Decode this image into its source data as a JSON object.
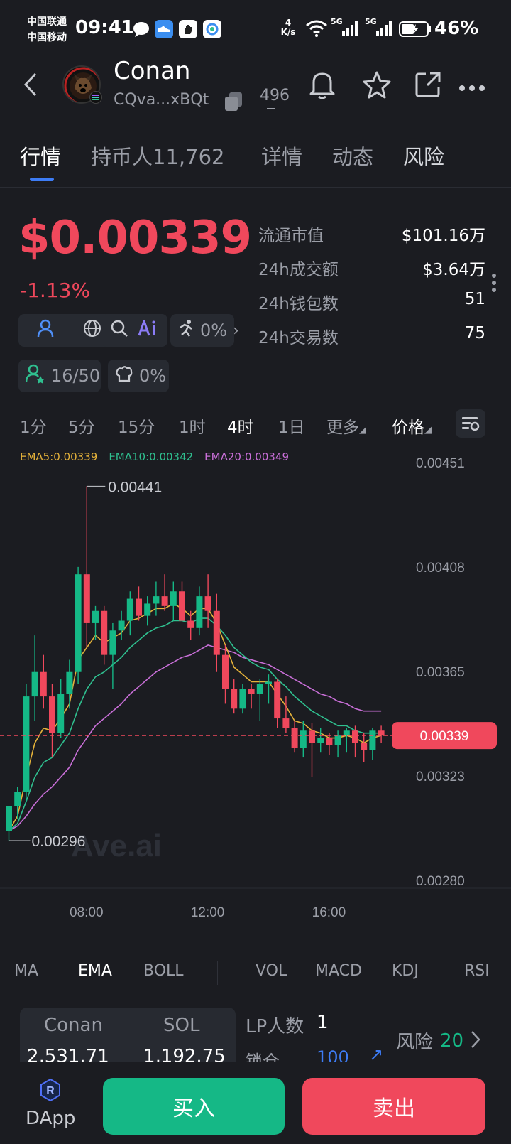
{
  "status_bar": {
    "carrier1": "中国联通",
    "carrier2": "中国移动",
    "time": "09:41",
    "net_speed_top": "4",
    "net_speed_bottom": "K/s",
    "sim1": "5G",
    "sim2": "5G",
    "battery": "46%"
  },
  "header": {
    "title": "Conan",
    "address": "CQva...xBQt",
    "count": "496"
  },
  "tabs": [
    {
      "label": "行情"
    },
    {
      "label": "持币人"
    },
    {
      "label": "详情"
    },
    {
      "label": "动态"
    },
    {
      "label": "风险"
    }
  ],
  "holders_count": "11,762",
  "price": {
    "value": "$0.00339",
    "change": "-1.13%",
    "chip_pct": "0%",
    "holders_ratio": "16/50",
    "chef_pct": "0%"
  },
  "stats": [
    {
      "label": "流通市值",
      "value": "$101.16万"
    },
    {
      "label": "24h成交额",
      "value": "$3.64万"
    },
    {
      "label": "24h钱包数",
      "value": "51"
    },
    {
      "label": "24h交易数",
      "value": "75"
    }
  ],
  "timeframes": [
    "1分",
    "5分",
    "15分",
    "1时",
    "4时",
    "1日",
    "更多",
    "价格"
  ],
  "ema_legend": {
    "ema5": "EMA5:0.00339",
    "ema10": "EMA10:0.00342",
    "ema20": "EMA20:0.00349"
  },
  "colors": {
    "up": "#15b886",
    "down": "#f0485c",
    "ema5": "#e5b23a",
    "ema10": "#2fbf8f",
    "ema20": "#c96fd8",
    "accent": "#3d7cf5"
  },
  "chart_data": {
    "type": "candlestick",
    "y_ticks": [
      "0.00451",
      "0.00408",
      "0.00365",
      "0.00323",
      "0.00280"
    ],
    "ylim": [
      0.0028,
      0.00451
    ],
    "x_ticks": [
      "08:00",
      "12:00",
      "16:00"
    ],
    "high_marker": "0.00441",
    "low_marker": "0.00296",
    "current_price": "0.00339",
    "watermark": "Ave.ai",
    "candles": [
      {
        "o": 0.003,
        "h": 0.0031,
        "l": 0.00296,
        "c": 0.0031
      },
      {
        "o": 0.0031,
        "h": 0.00318,
        "l": 0.00305,
        "c": 0.00316
      },
      {
        "o": 0.00316,
        "h": 0.0036,
        "l": 0.00312,
        "c": 0.00355
      },
      {
        "o": 0.00355,
        "h": 0.0038,
        "l": 0.00345,
        "c": 0.00365
      },
      {
        "o": 0.00365,
        "h": 0.00372,
        "l": 0.0035,
        "c": 0.00355
      },
      {
        "o": 0.00355,
        "h": 0.0036,
        "l": 0.0033,
        "c": 0.0034
      },
      {
        "o": 0.0034,
        "h": 0.00362,
        "l": 0.00338,
        "c": 0.00356
      },
      {
        "o": 0.00356,
        "h": 0.0037,
        "l": 0.0035,
        "c": 0.00365
      },
      {
        "o": 0.00365,
        "h": 0.00408,
        "l": 0.0036,
        "c": 0.00405
      },
      {
        "o": 0.00405,
        "h": 0.00441,
        "l": 0.00375,
        "c": 0.00385
      },
      {
        "o": 0.00385,
        "h": 0.00392,
        "l": 0.00378,
        "c": 0.0039
      },
      {
        "o": 0.0039,
        "h": 0.00392,
        "l": 0.00368,
        "c": 0.00372
      },
      {
        "o": 0.00372,
        "h": 0.00385,
        "l": 0.00358,
        "c": 0.00382
      },
      {
        "o": 0.00382,
        "h": 0.0039,
        "l": 0.00378,
        "c": 0.00386
      },
      {
        "o": 0.00386,
        "h": 0.00398,
        "l": 0.0038,
        "c": 0.00395
      },
      {
        "o": 0.00395,
        "h": 0.004,
        "l": 0.00386,
        "c": 0.00388
      },
      {
        "o": 0.00388,
        "h": 0.00396,
        "l": 0.00384,
        "c": 0.00393
      },
      {
        "o": 0.00393,
        "h": 0.00402,
        "l": 0.00388,
        "c": 0.00396
      },
      {
        "o": 0.00396,
        "h": 0.00405,
        "l": 0.0039,
        "c": 0.00392
      },
      {
        "o": 0.00392,
        "h": 0.00402,
        "l": 0.00386,
        "c": 0.00398
      },
      {
        "o": 0.00398,
        "h": 0.00402,
        "l": 0.0039,
        "c": 0.00386
      },
      {
        "o": 0.00386,
        "h": 0.0039,
        "l": 0.00378,
        "c": 0.00383
      },
      {
        "o": 0.00383,
        "h": 0.004,
        "l": 0.0038,
        "c": 0.00396
      },
      {
        "o": 0.00396,
        "h": 0.00405,
        "l": 0.00383,
        "c": 0.0039
      },
      {
        "o": 0.0039,
        "h": 0.00397,
        "l": 0.00365,
        "c": 0.00372
      },
      {
        "o": 0.00372,
        "h": 0.00376,
        "l": 0.00352,
        "c": 0.00358
      },
      {
        "o": 0.00358,
        "h": 0.00362,
        "l": 0.00348,
        "c": 0.0035
      },
      {
        "o": 0.0035,
        "h": 0.0036,
        "l": 0.00348,
        "c": 0.00358
      },
      {
        "o": 0.00358,
        "h": 0.0036,
        "l": 0.0035,
        "c": 0.00356
      },
      {
        "o": 0.00356,
        "h": 0.00362,
        "l": 0.00345,
        "c": 0.0036
      },
      {
        "o": 0.0036,
        "h": 0.00364,
        "l": 0.00352,
        "c": 0.00361
      },
      {
        "o": 0.00361,
        "h": 0.00362,
        "l": 0.00342,
        "c": 0.00346
      },
      {
        "o": 0.00346,
        "h": 0.00355,
        "l": 0.0034,
        "c": 0.00342
      },
      {
        "o": 0.00342,
        "h": 0.00345,
        "l": 0.00332,
        "c": 0.00334
      },
      {
        "o": 0.00334,
        "h": 0.00345,
        "l": 0.0033,
        "c": 0.00341
      },
      {
        "o": 0.00341,
        "h": 0.00344,
        "l": 0.00322,
        "c": 0.00336
      },
      {
        "o": 0.00336,
        "h": 0.00342,
        "l": 0.00332,
        "c": 0.00338
      },
      {
        "o": 0.00338,
        "h": 0.0034,
        "l": 0.00331,
        "c": 0.00335
      },
      {
        "o": 0.00335,
        "h": 0.00341,
        "l": 0.0033,
        "c": 0.00339
      },
      {
        "o": 0.00339,
        "h": 0.00342,
        "l": 0.00332,
        "c": 0.00341
      },
      {
        "o": 0.00341,
        "h": 0.00343,
        "l": 0.0033,
        "c": 0.00336
      },
      {
        "o": 0.00336,
        "h": 0.0034,
        "l": 0.00328,
        "c": 0.00333
      },
      {
        "o": 0.00333,
        "h": 0.00342,
        "l": 0.00329,
        "c": 0.00341
      },
      {
        "o": 0.00341,
        "h": 0.00343,
        "l": 0.00336,
        "c": 0.00339
      }
    ],
    "ema5": [
      0.003,
      0.00306,
      0.00322,
      0.00336,
      0.00342,
      0.00341,
      0.00346,
      0.00352,
      0.0037,
      0.00375,
      0.0038,
      0.00377,
      0.00379,
      0.00381,
      0.00386,
      0.00387,
      0.00389,
      0.00391,
      0.00391,
      0.00393,
      0.00391,
      0.00388,
      0.00391,
      0.00391,
      0.00385,
      0.00376,
      0.00367,
      0.00364,
      0.00361,
      0.00361,
      0.00361,
      0.00356,
      0.00351,
      0.00345,
      0.00344,
      0.00341,
      0.0034,
      0.00338,
      0.00338,
      0.00339,
      0.00338,
      0.00336,
      0.00338,
      0.00339
    ],
    "ema10": [
      0.003,
      0.00303,
      0.00312,
      0.00322,
      0.00328,
      0.0033,
      0.00335,
      0.0034,
      0.0035,
      0.00358,
      0.00363,
      0.00365,
      0.00368,
      0.00371,
      0.00375,
      0.00378,
      0.00381,
      0.00383,
      0.00384,
      0.00386,
      0.00386,
      0.00385,
      0.00387,
      0.00387,
      0.00384,
      0.0038,
      0.00375,
      0.00372,
      0.00369,
      0.00367,
      0.00366,
      0.00362,
      0.00359,
      0.00355,
      0.00352,
      0.00349,
      0.00347,
      0.00345,
      0.00343,
      0.00343,
      0.00341,
      0.0034,
      0.0034,
      0.0034
    ],
    "ema20": [
      0.003,
      0.00302,
      0.00306,
      0.00311,
      0.00315,
      0.00318,
      0.00322,
      0.00326,
      0.00333,
      0.00338,
      0.00343,
      0.00346,
      0.00349,
      0.00352,
      0.00356,
      0.00359,
      0.00362,
      0.00365,
      0.00367,
      0.00369,
      0.00371,
      0.00372,
      0.00374,
      0.00376,
      0.00375,
      0.00374,
      0.00373,
      0.00371,
      0.0037,
      0.00369,
      0.00368,
      0.00366,
      0.00364,
      0.00362,
      0.0036,
      0.00358,
      0.00356,
      0.00355,
      0.00353,
      0.00352,
      0.0035,
      0.00349,
      0.00349,
      0.00349
    ]
  },
  "indicators_main": [
    "MA",
    "EMA",
    "BOLL"
  ],
  "indicators_sub": [
    "VOL",
    "MACD",
    "KDJ",
    "RSI"
  ],
  "pool": {
    "token_a": "Conan",
    "amount_a": "2,531.71",
    "token_b": "SOL",
    "amount_b": "1,192.75",
    "lp_label": "LP人数",
    "lp_count": "1",
    "lock_label": "锁仓",
    "lock_value": "100",
    "risk_label": "风险",
    "risk_value": "20"
  },
  "bottom": {
    "dapp": "DApp",
    "buy": "买入",
    "sell": "卖出"
  }
}
